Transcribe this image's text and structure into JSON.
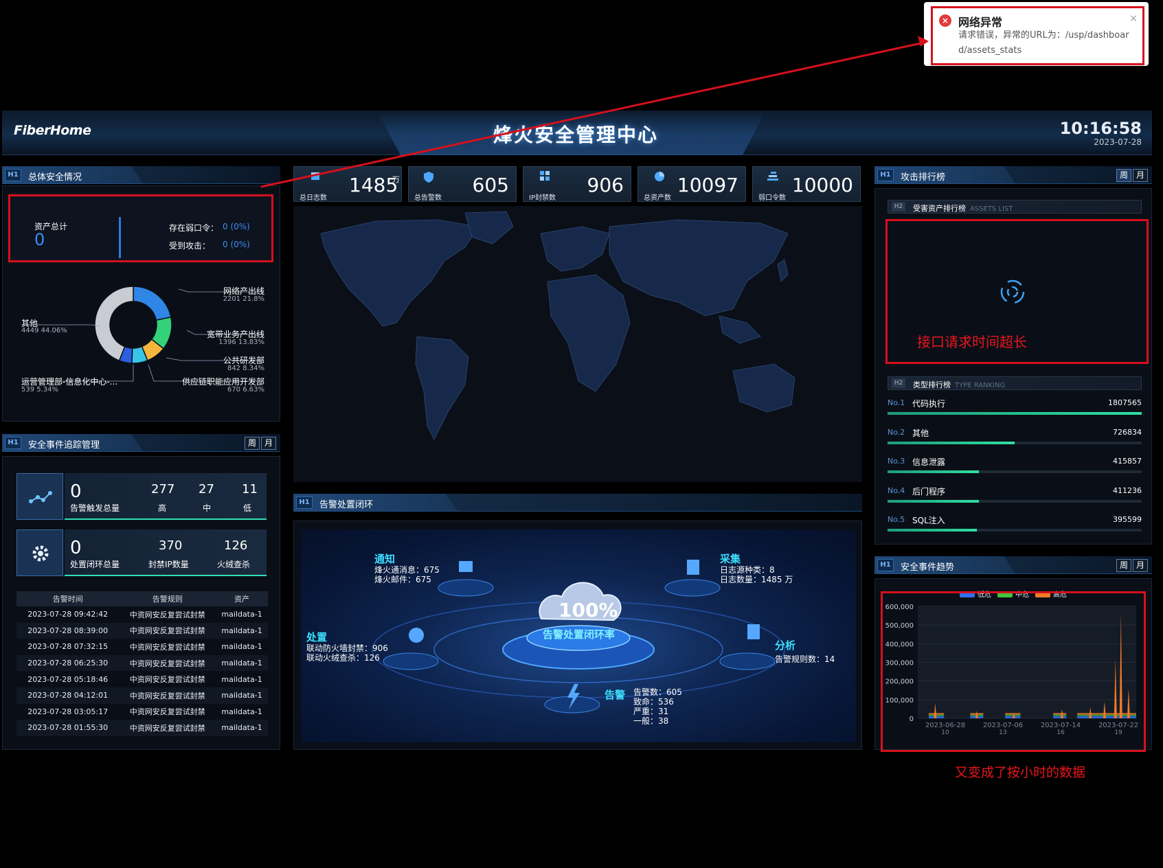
{
  "toast": {
    "title": "网络异常",
    "message": "请求错误，异常的URL为：/usp/dashboard/assets_stats",
    "close": "×",
    "error_icon": "×"
  },
  "header": {
    "logo": "FiberHome",
    "title": "烽火安全管理中心",
    "time": "10:16:58",
    "date": "2023-07-28"
  },
  "overall": {
    "tag": "H1",
    "title": "总体安全情况",
    "assets_label": "资产总计",
    "assets_value": "0",
    "weak_label": "存在弱口令：",
    "weak_value": "0 (0%)",
    "attack_label": "受到攻击：",
    "attack_value": "0 (0%)",
    "donut": {
      "slices": [
        {
          "name": "网络产出线",
          "value": 2201,
          "pct": "21.8%",
          "color": "#2f86e6"
        },
        {
          "name": "宽带业务产出线",
          "value": 1396,
          "pct": "13.83%",
          "color": "#33d17a"
        },
        {
          "name": "公共研发部",
          "value": 842,
          "pct": "8.34%",
          "color": "#f5b73b"
        },
        {
          "name": "供应链职能应用开发部",
          "value": 670,
          "pct": "6.63%",
          "color": "#38c6e8"
        },
        {
          "name": "运营管理部-信息化中心-...",
          "value": 539,
          "pct": "5.34%",
          "color": "#2a5fe0"
        },
        {
          "name": "其他",
          "value": 4449,
          "pct": "44.06%",
          "color": "#c9cdd3"
        }
      ],
      "labels": {
        "l1_name": "网络产出线",
        "l1_val": "2201 21.8%",
        "l2_name": "宽带业务产出线",
        "l2_val": "1396 13.83%",
        "l3_name": "公共研发部",
        "l3_val": "842 8.34%",
        "l4_name": "供应链职能应用开发部",
        "l4_val": "670 6.63%",
        "l5_name": "运营管理部-信息化中心-...",
        "l5_val": "539 5.34%",
        "l6_name": "其他",
        "l6_val": "4449 44.06%"
      }
    }
  },
  "stats": [
    {
      "label": "总日志数",
      "value": "1485",
      "unit": "万"
    },
    {
      "label": "总告警数",
      "value": "605",
      "unit": ""
    },
    {
      "label": "IP封禁数",
      "value": "906",
      "unit": ""
    },
    {
      "label": "总资产数",
      "value": "10097",
      "unit": ""
    },
    {
      "label": "弱口令数",
      "value": "10000",
      "unit": ""
    }
  ],
  "events": {
    "tag": "H1",
    "title": "安全事件追踪管理",
    "tab_week": "周",
    "tab_month": "月",
    "trigger_total": "0",
    "trigger_label": "告警触发总量",
    "high_val": "277",
    "high_label": "高",
    "mid_val": "27",
    "mid_label": "中",
    "low_val": "11",
    "low_label": "低",
    "closed_total": "0",
    "closed_label": "处置闭环总量",
    "ban_val": "370",
    "ban_label": "封禁IP数量",
    "fire_val": "126",
    "fire_label": "火绒查杀",
    "table": {
      "headers": [
        "告警时间",
        "告警规则",
        "资产"
      ],
      "rows": [
        [
          "2023-07-28 09:42:42",
          "中资网安反复尝试封禁",
          "maildata-1"
        ],
        [
          "2023-07-28 08:39:00",
          "中资网安反复尝试封禁",
          "maildata-1"
        ],
        [
          "2023-07-28 07:32:15",
          "中资网安反复尝试封禁",
          "maildata-1"
        ],
        [
          "2023-07-28 06:25:30",
          "中资网安反复尝试封禁",
          "maildata-1"
        ],
        [
          "2023-07-28 05:18:46",
          "中资网安反复尝试封禁",
          "maildata-1"
        ],
        [
          "2023-07-28 04:12:01",
          "中资网安反复尝试封禁",
          "maildata-1"
        ],
        [
          "2023-07-28 03:05:17",
          "中资网安反复尝试封禁",
          "maildata-1"
        ],
        [
          "2023-07-28 01:55:30",
          "中资网安反复尝试封禁",
          "maildata-1"
        ]
      ]
    }
  },
  "loop": {
    "tag": "H1",
    "title": "告警处置闭环",
    "rate": "100%",
    "rate_label": "告警处置闭环率",
    "notify": {
      "head": "通知",
      "l1": "烽火通消息：675",
      "l2": "烽火邮件：675"
    },
    "collect": {
      "head": "采集",
      "l1": "日志源种类：8",
      "l2": "日志数量：1485 万"
    },
    "handle": {
      "head": "处置",
      "l1": "联动防火墙封禁：906",
      "l2": "联动火绒查杀：126"
    },
    "analyze": {
      "head": "分析",
      "l1": "告警规则数：14"
    },
    "alarm": {
      "head": "告警",
      "l1": "告警数：605",
      "l2": "致命：536",
      "l3": "严重：31",
      "l4": "一般：38"
    }
  },
  "attack": {
    "tag": "H1",
    "title": "攻击排行榜",
    "tab_week": "周",
    "tab_month": "月",
    "assets_list_title": "受害资产排行榜",
    "assets_list_sub": "ASSETS LIST",
    "timeout_note": "接口请求时间超长",
    "type_title": "类型排行榜",
    "type_sub": "TYPE RANKING",
    "ranking": [
      {
        "no": "No.1",
        "name": "代码执行",
        "value": "1807565",
        "ratio": 1.0
      },
      {
        "no": "No.2",
        "name": "其他",
        "value": "726834",
        "ratio": 0.5
      },
      {
        "no": "No.3",
        "name": "信息泄露",
        "value": "415857",
        "ratio": 0.36
      },
      {
        "no": "No.4",
        "name": "后门程序",
        "value": "411236",
        "ratio": 0.36
      },
      {
        "no": "No.5",
        "name": "SQL注入",
        "value": "395599",
        "ratio": 0.35
      }
    ]
  },
  "trend": {
    "tag": "H1",
    "title": "安全事件趋势",
    "tab_week": "周",
    "tab_month": "月",
    "note": "又变成了按小时的数据"
  },
  "chart_data": {
    "type": "area",
    "legend": [
      "低危",
      "中危",
      "高危"
    ],
    "colors": [
      "#2f6ff0",
      "#3fc43c",
      "#f07a2a"
    ],
    "ylim": [
      0,
      600000
    ],
    "yticks": [
      "600,000",
      "500,000",
      "400,000",
      "300,000",
      "200,000",
      "100,000",
      "0"
    ],
    "xticks": [
      {
        "l1": "2023-06-28",
        "l2": "10"
      },
      {
        "l1": "2023-07-06",
        "l2": "13"
      },
      {
        "l1": "2023-07-14",
        "l2": "16"
      },
      {
        "l1": "2023-07-22",
        "l2": "19"
      }
    ],
    "spikes": [
      {
        "x": 0.08,
        "y": 80000
      },
      {
        "x": 0.27,
        "y": 40000
      },
      {
        "x": 0.44,
        "y": 30000
      },
      {
        "x": 0.66,
        "y": 50000
      },
      {
        "x": 0.79,
        "y": 60000
      },
      {
        "x": 0.855,
        "y": 90000
      },
      {
        "x": 0.905,
        "y": 320000
      },
      {
        "x": 0.93,
        "y": 560000
      },
      {
        "x": 0.965,
        "y": 160000
      }
    ]
  }
}
